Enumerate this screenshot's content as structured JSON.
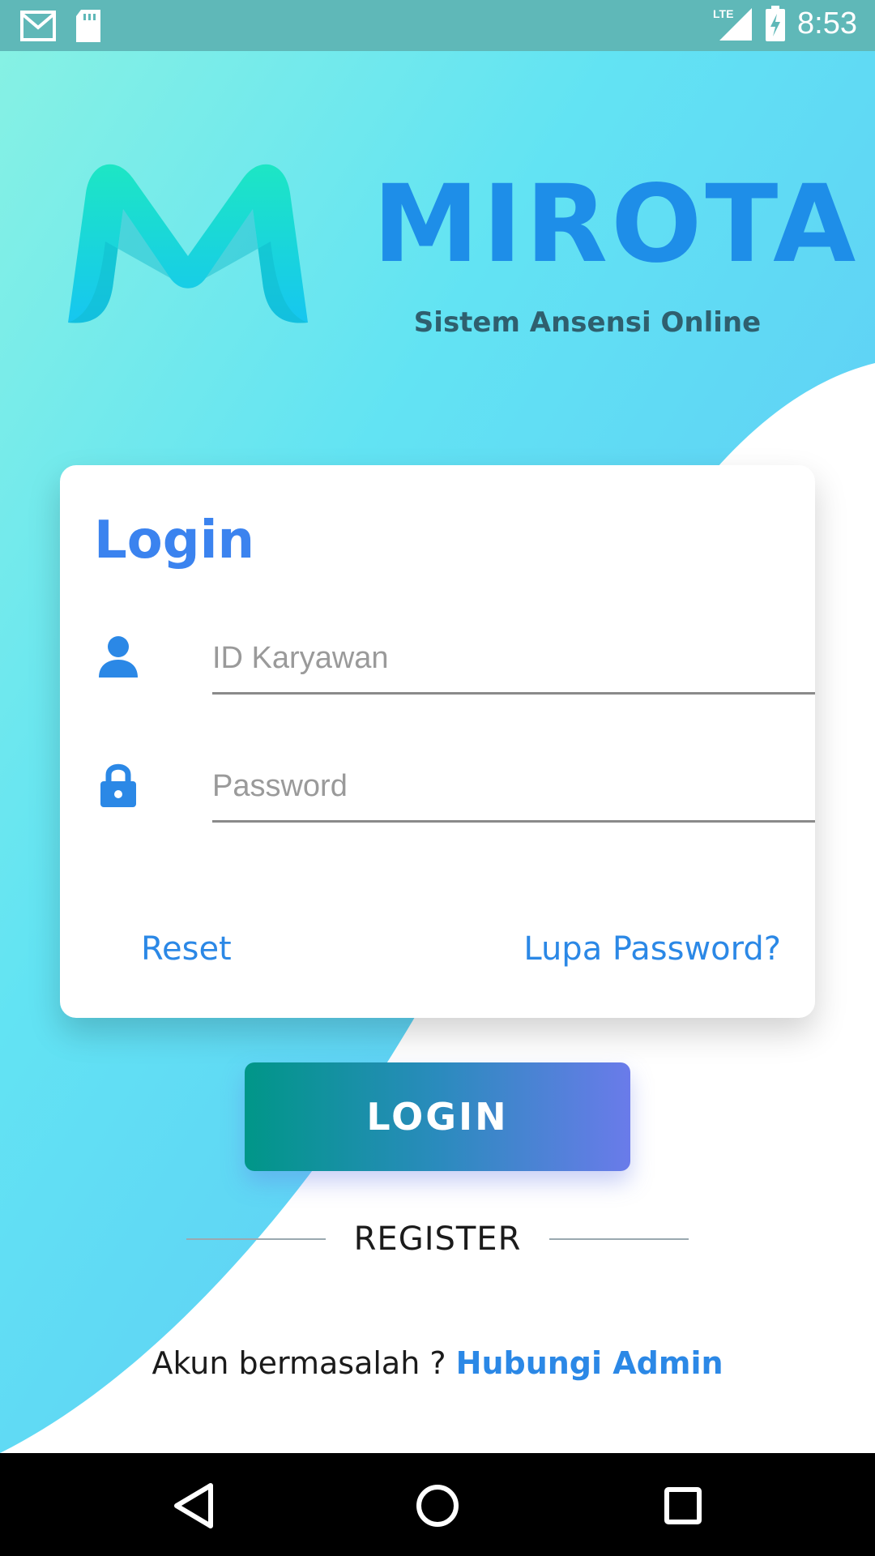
{
  "status_bar": {
    "time": "8:53",
    "network": "LTE",
    "icons": [
      "gmail-icon",
      "sd-card-icon",
      "signal-icon",
      "battery-charging-icon"
    ]
  },
  "header": {
    "app_name": "MIROTA",
    "subtitle": "Sistem Ansensi Online"
  },
  "login_card": {
    "title": "Login",
    "id_field": {
      "placeholder": "ID Karyawan",
      "value": "",
      "icon": "person-icon"
    },
    "password_field": {
      "placeholder": "Password",
      "value": "",
      "icon": "lock-icon"
    },
    "reset_label": "Reset",
    "forgot_label": "Lupa Password?"
  },
  "login_button_label": "LOGIN",
  "register_label": "REGISTER",
  "help": {
    "prefix": "Akun bermasalah ? ",
    "link": "Hubungi Admin"
  },
  "nav_bar": {
    "icons": [
      "back-icon",
      "home-icon",
      "recents-icon"
    ]
  },
  "colors": {
    "primary_blue": "#1e8ee8",
    "link_blue": "#2b88e6",
    "gradient_start": "#009688",
    "gradient_end": "#6a7bea",
    "bg_cyan": "#5fe0f0"
  }
}
